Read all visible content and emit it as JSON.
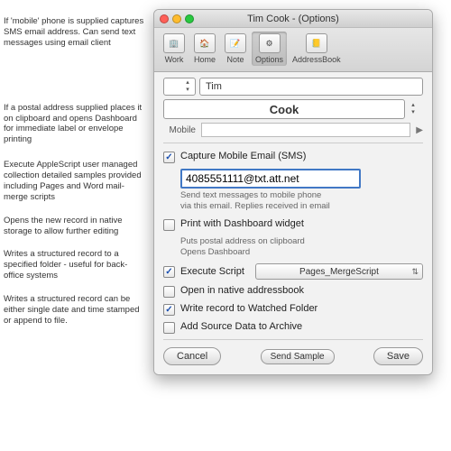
{
  "window": {
    "title": "Tim Cook - (Options)"
  },
  "toolbar": {
    "work": "Work",
    "home": "Home",
    "note": "Note",
    "options": "Options",
    "addressbook": "AddressBook"
  },
  "name": {
    "first": "Tim",
    "last": "Cook"
  },
  "mobile": {
    "label": "Mobile",
    "value": ""
  },
  "options": {
    "capture_sms": {
      "label": "Capture Mobile Email (SMS)",
      "checked": true,
      "value": "4085551111@txt.att.net",
      "help1": "Send text messages to mobile phone",
      "help2": "via this email. Replies received in email"
    },
    "dashboard": {
      "label": "Print with Dashboard widget",
      "checked": false,
      "help1": "Puts postal address on clipboard",
      "help2": "Opens Dashboard"
    },
    "script": {
      "label": "Execute Script",
      "checked": true,
      "selected": "Pages_MergeScript"
    },
    "open_native": {
      "label": "Open in native addressbook",
      "checked": false
    },
    "watched": {
      "label": "Write record to Watched Folder",
      "checked": true
    },
    "archive": {
      "label": "Add Source Data to Archive",
      "checked": false
    }
  },
  "buttons": {
    "cancel": "Cancel",
    "send_sample": "Send Sample",
    "save": "Save"
  },
  "annotations": {
    "a1": "If 'mobile' phone is supplied captures SMS email address. Can send text messages using email client",
    "a2": "If a postal address supplied places it on clipboard and opens Dashboard for immediate label or envelope printing",
    "a3": "Execute AppleScript user managed collection detailed samples provided including Pages and Word mail-merge scripts",
    "a4": "Opens the new record in native storage to allow further editing",
    "a5": "Writes a structured record to a specified folder - useful for back-office systems",
    "a6": "Writes a structured record can be either single date and time stamped or append to file."
  }
}
